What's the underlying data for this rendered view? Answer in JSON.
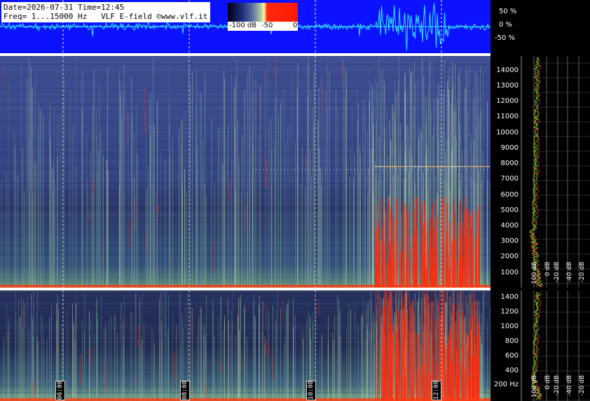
{
  "header": {
    "date_line": "Date=2026-07-31 Time=12:45",
    "freq_line": "Freq= 1...15000 Hz   VLF E-field ©www.vlf.it"
  },
  "colorbar": {
    "labels": [
      "-100 dB",
      "-50",
      "0"
    ],
    "colors": [
      "#000010",
      "#1c2a7a",
      "#b7cf9c",
      "#fff6a8",
      "#ff2a0a"
    ]
  },
  "amplitude_axis": {
    "labels": [
      "50 %",
      "0 %",
      "-50 %"
    ]
  },
  "upper_freq_axis": {
    "labels": [
      "14000",
      "13000",
      "12000",
      "11000",
      "10000",
      "9000",
      "8000",
      "7000",
      "6000",
      "5000",
      "4000",
      "3000",
      "2000",
      "1000"
    ]
  },
  "lower_freq_axis": {
    "labels": [
      "1400",
      "1200",
      "1000",
      "800",
      "600",
      "400",
      "200 Hz"
    ]
  },
  "level_axis": {
    "upper_labels": [
      "100 dB",
      "0 dB",
      "-20 dB",
      "-40 dB",
      "-20 dB"
    ],
    "lower_labels": [
      "100 dB",
      "0 dB",
      "-20 dB",
      "-40 dB",
      "-20 dB"
    ]
  },
  "time_axis": {
    "labels": [
      "06:00",
      "08:00",
      "10:00",
      "12:00"
    ]
  },
  "colors": {
    "waveform_bg": "#0a12ff",
    "waveform": "#33e6ff",
    "spectrum_bg": "#24306e",
    "lightning": "#ff2a0a"
  }
}
